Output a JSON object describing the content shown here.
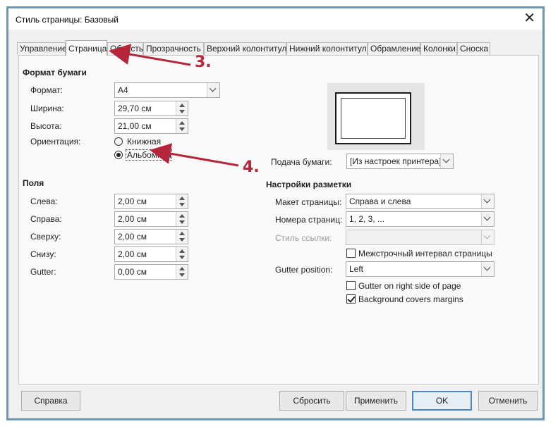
{
  "window": {
    "title": "Стиль страницы: Базовый",
    "close_glyph": "✕"
  },
  "tabs": [
    {
      "label": "Управление",
      "active": false
    },
    {
      "label": "Страница",
      "active": true
    },
    {
      "label": "Область",
      "active": false
    },
    {
      "label": "Прозрачность",
      "active": false
    },
    {
      "label": "Верхний колонтитул",
      "active": false
    },
    {
      "label": "Нижний колонтитул",
      "active": false
    },
    {
      "label": "Обрамление",
      "active": false
    },
    {
      "label": "Колонки",
      "active": false
    },
    {
      "label": "Сноска",
      "active": false
    }
  ],
  "paper_format": {
    "section_title": "Формат бумаги",
    "format_label": "Формат:",
    "format_value": "A4",
    "width_label": "Ширина:",
    "width_value": "29,70 см",
    "height_label": "Высота:",
    "height_value": "21,00 см",
    "orientation_label": "Ориентация:",
    "portrait_label": "Книжная",
    "landscape_label": "Альбомная",
    "selected_orientation": "landscape"
  },
  "paper_source": {
    "label": "Подача бумаги:",
    "value": "[Из настроек принтера]"
  },
  "margins": {
    "section_title": "Поля",
    "left_label": "Слева:",
    "left_value": "2,00 см",
    "right_label": "Справа:",
    "right_value": "2,00 см",
    "top_label": "Сверху:",
    "top_value": "2,00 см",
    "bottom_label": "Снизу:",
    "bottom_value": "2,00 см",
    "gutter_label": "Gutter:",
    "gutter_value": "0,00 см"
  },
  "layout": {
    "section_title": "Настройки разметки",
    "page_layout_label": "Макет страницы:",
    "page_layout_value": "Справа и слева",
    "page_numbers_label": "Номера страниц:",
    "page_numbers_value": "1, 2, 3, ...",
    "ref_style_label": "Стиль ссылки:",
    "ref_style_value": "",
    "register_true_label": "Межстрочный интервал страницы",
    "register_true_checked": false,
    "gutter_position_label": "Gutter position:",
    "gutter_position_value": "Left",
    "gutter_right_label": "Gutter on right side of page",
    "gutter_right_checked": false,
    "background_covers_label": "Background covers margins",
    "background_covers_checked": true
  },
  "buttons": {
    "help": "Справка",
    "reset": "Сбросить",
    "apply": "Применить",
    "ok": "OK",
    "cancel": "Отменить"
  },
  "annotations": {
    "step3": "3.",
    "step4": "4.",
    "arrow_color": "#b5263b"
  }
}
